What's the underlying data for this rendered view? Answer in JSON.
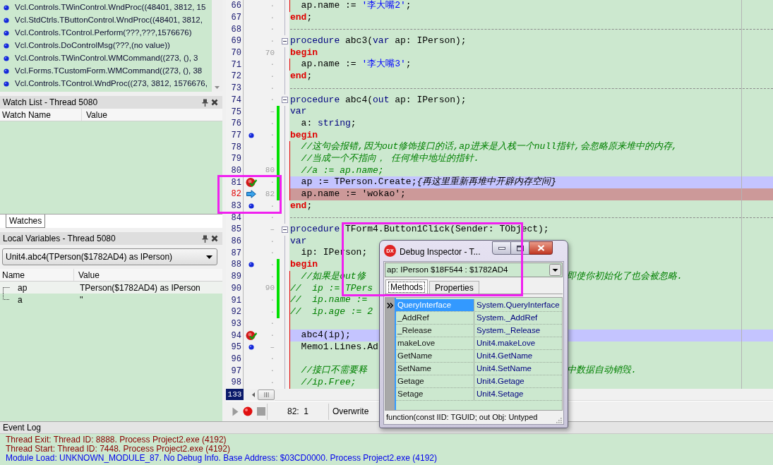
{
  "call_stack": {
    "frames": [
      "Vcl.Controls.TWinControl.WndProc((48401, 3812, 15",
      "Vcl.StdCtrls.TButtonControl.WndProc((48401, 3812,",
      "Vcl.Controls.TControl.Perform(???,???,1576676)",
      "Vcl.Controls.DoControlMsg(???,(no value))",
      "Vcl.Controls.TWinControl.WMCommand((273, (), 3",
      "Vcl.Forms.TCustomForm.WMCommand((273, (), 38",
      "Vcl.Controls.TControl.WndProc((273, 3812, 1576676,"
    ]
  },
  "watch_list": {
    "title": "Watch List - Thread 5080",
    "columns": [
      "Watch Name",
      "Value"
    ],
    "tabs": [
      {
        "label": "Watches",
        "selected": true
      }
    ]
  },
  "local_variables": {
    "title": "Local Variables - Thread 5080",
    "frame": "Unit4.abc4(TPerson($1782AD4) as IPerson)",
    "columns": [
      "Name",
      "Value"
    ],
    "rows": [
      {
        "name": "ap",
        "value": "TPerson($1782AD4) as IPerson",
        "selected": true
      },
      {
        "name": "a",
        "value": "''",
        "selected": false
      }
    ]
  },
  "editor": {
    "lines": [
      {
        "number": "66",
        "mark": "·",
        "kind": "code",
        "compiled": false,
        "modified": false,
        "fold": false,
        "block_guide": true,
        "tokens": [
          {
            "text": "  ap.name := ",
            "kind": "plain"
          },
          {
            "text": "'李大嘴2'",
            "kind": "string"
          },
          {
            "text": ";",
            "kind": "plain"
          }
        ]
      },
      {
        "number": "67",
        "mark": "·",
        "kind": "code",
        "compiled": false,
        "modified": false,
        "fold": false,
        "block_guide": false,
        "tokens": [
          {
            "text": "end",
            "kind": "reserved"
          },
          {
            "text": ";",
            "kind": "plain"
          }
        ]
      },
      {
        "number": "68",
        "mark": "·",
        "kind": "separator",
        "compiled": false,
        "modified": false,
        "fold": false,
        "block_guide": false
      },
      {
        "number": "69",
        "mark": "·",
        "kind": "code",
        "compiled": false,
        "modified": false,
        "fold": true,
        "block_guide": false,
        "tokens": [
          {
            "text": "procedure",
            "kind": "keyword"
          },
          {
            "text": " abc3(",
            "kind": "plain"
          },
          {
            "text": "var",
            "kind": "keyword"
          },
          {
            "text": " ap: IPerson);",
            "kind": "plain"
          }
        ]
      },
      {
        "number": "70",
        "mark": "70",
        "kind": "code",
        "compiled": false,
        "modified": false,
        "fold": false,
        "block_guide": false,
        "tokens": [
          {
            "text": "begin",
            "kind": "reserved"
          }
        ]
      },
      {
        "number": "71",
        "mark": "·",
        "kind": "code",
        "compiled": false,
        "modified": false,
        "fold": false,
        "block_guide": true,
        "tokens": [
          {
            "text": "  ap.name := ",
            "kind": "plain"
          },
          {
            "text": "'李大嘴3'",
            "kind": "string"
          },
          {
            "text": ";",
            "kind": "plain"
          }
        ]
      },
      {
        "number": "72",
        "mark": "·",
        "kind": "code",
        "compiled": false,
        "modified": false,
        "fold": false,
        "block_guide": false,
        "tokens": [
          {
            "text": "end",
            "kind": "reserved"
          },
          {
            "text": ";",
            "kind": "plain"
          }
        ]
      },
      {
        "number": "73",
        "mark": "·",
        "kind": "separator",
        "compiled": false,
        "modified": false,
        "fold": false,
        "block_guide": false
      },
      {
        "number": "74",
        "mark": "·",
        "kind": "code",
        "compiled": false,
        "modified": false,
        "fold": true,
        "block_guide": false,
        "tokens": [
          {
            "text": "procedure",
            "kind": "keyword"
          },
          {
            "text": " abc4(",
            "kind": "plain"
          },
          {
            "text": "out",
            "kind": "keyword"
          },
          {
            "text": " ap: IPerson);",
            "kind": "plain"
          }
        ]
      },
      {
        "number": "75",
        "mark": "–",
        "kind": "code",
        "compiled": false,
        "modified": true,
        "fold": false,
        "block_guide": false,
        "tokens": [
          {
            "text": "var",
            "kind": "keyword"
          }
        ]
      },
      {
        "number": "76",
        "mark": "·",
        "kind": "code",
        "compiled": false,
        "modified": true,
        "fold": false,
        "block_guide": false,
        "tokens": [
          {
            "text": "  a: ",
            "kind": "plain"
          },
          {
            "text": "string",
            "kind": "keyword"
          },
          {
            "text": ";",
            "kind": "plain"
          }
        ]
      },
      {
        "number": "77",
        "mark": "·",
        "kind": "code",
        "compiled": true,
        "modified": true,
        "fold": false,
        "block_guide": false,
        "tokens": [
          {
            "text": "begin",
            "kind": "reserved"
          }
        ]
      },
      {
        "number": "78",
        "mark": "·",
        "kind": "code",
        "compiled": false,
        "modified": true,
        "fold": false,
        "block_guide": true,
        "tokens": [
          {
            "text": "  //这句会报错,因为out修饰接口的话,ap进来是入栈一个null指针,会忽略原来堆中的内存,",
            "kind": "comment"
          }
        ]
      },
      {
        "number": "79",
        "mark": "·",
        "kind": "code",
        "compiled": false,
        "modified": true,
        "fold": false,
        "block_guide": true,
        "tokens": [
          {
            "text": "  //当成一个不指向， 任何堆中地址的指针.",
            "kind": "comment"
          }
        ]
      },
      {
        "number": "80",
        "mark": "80",
        "kind": "code",
        "compiled": false,
        "modified": true,
        "fold": false,
        "block_guide": true,
        "tokens": [
          {
            "text": "  //a := ap.name;",
            "kind": "comment"
          }
        ]
      },
      {
        "number": "81",
        "mark": "·",
        "kind": "breakpoint",
        "compiled": false,
        "modified": true,
        "fold": false,
        "block_guide": true,
        "tokens": [
          {
            "text": "  ap := TPerson.Create;",
            "kind": "plain"
          },
          {
            "text": "{再这里重新再堆中开辟内存空间}",
            "kind": "comment"
          }
        ]
      },
      {
        "number": "82",
        "mark": "82",
        "kind": "execution",
        "compiled": false,
        "modified": true,
        "fold": false,
        "block_guide": true,
        "tokens": [
          {
            "text": "  ap.name := ",
            "kind": "plain"
          },
          {
            "text": "'wokao'",
            "kind": "string"
          },
          {
            "text": ";",
            "kind": "plain"
          }
        ]
      },
      {
        "number": "83",
        "mark": "·",
        "kind": "code",
        "compiled": true,
        "modified": false,
        "fold": false,
        "block_guide": false,
        "tokens": [
          {
            "text": "end",
            "kind": "reserved"
          },
          {
            "text": ";",
            "kind": "plain"
          }
        ]
      },
      {
        "number": "84",
        "mark": "·",
        "kind": "separator",
        "compiled": false,
        "modified": false,
        "fold": false,
        "block_guide": false
      },
      {
        "number": "85",
        "mark": "–",
        "kind": "code",
        "compiled": false,
        "modified": false,
        "fold": true,
        "block_guide": false,
        "tokens": [
          {
            "text": "procedure",
            "kind": "keyword"
          },
          {
            "text": " TForm4.Button1Click(Sender: TObject);",
            "kind": "plain"
          }
        ]
      },
      {
        "number": "86",
        "mark": "·",
        "kind": "code",
        "compiled": false,
        "modified": false,
        "fold": false,
        "block_guide": false,
        "tokens": [
          {
            "text": "var",
            "kind": "keyword"
          }
        ]
      },
      {
        "number": "87",
        "mark": "·",
        "kind": "code",
        "compiled": false,
        "modified": false,
        "fold": false,
        "block_guide": false,
        "tokens": [
          {
            "text": "  ip: IPerson;",
            "kind": "plain"
          }
        ]
      },
      {
        "number": "88",
        "mark": "·",
        "kind": "code",
        "compiled": true,
        "modified": true,
        "fold": false,
        "block_guide": false,
        "tokens": [
          {
            "text": "begin",
            "kind": "reserved"
          }
        ]
      },
      {
        "number": "89",
        "mark": "·",
        "kind": "code",
        "compiled": false,
        "modified": true,
        "fold": false,
        "block_guide": true,
        "tokens": [
          {
            "text": "  //如果是out修",
            "kind": "comment"
          }
        ],
        "tokens_right": [
          {
            "text": "即使你初始化了也会被忽略.",
            "kind": "comment"
          }
        ]
      },
      {
        "number": "90",
        "mark": "90",
        "kind": "code",
        "compiled": false,
        "modified": true,
        "fold": false,
        "block_guide": true,
        "tokens": [
          {
            "text": "//  ip := TPers",
            "kind": "comment"
          }
        ]
      },
      {
        "number": "91",
        "mark": "·",
        "kind": "code",
        "compiled": false,
        "modified": true,
        "fold": false,
        "block_guide": true,
        "tokens": [
          {
            "text": "//  ip.name :=",
            "kind": "comment"
          }
        ]
      },
      {
        "number": "92",
        "mark": "·",
        "kind": "code",
        "compiled": false,
        "modified": true,
        "fold": false,
        "block_guide": true,
        "tokens": [
          {
            "text": "//  ip.age := 2",
            "kind": "comment"
          }
        ]
      },
      {
        "number": "93",
        "mark": "·",
        "kind": "code",
        "compiled": false,
        "modified": false,
        "fold": false,
        "block_guide": true
      },
      {
        "number": "94",
        "mark": "·",
        "kind": "breakpoint",
        "compiled": false,
        "modified": false,
        "fold": false,
        "block_guide": true,
        "tokens": [
          {
            "text": "  abc4(ip);",
            "kind": "plain"
          }
        ]
      },
      {
        "number": "95",
        "mark": "–",
        "kind": "code",
        "compiled": true,
        "modified": false,
        "fold": false,
        "block_guide": true,
        "tokens": [
          {
            "text": "  Memo1.Lines.Ad",
            "kind": "plain"
          }
        ]
      },
      {
        "number": "96",
        "mark": "·",
        "kind": "code",
        "compiled": false,
        "modified": false,
        "fold": false,
        "block_guide": true
      },
      {
        "number": "97",
        "mark": "·",
        "kind": "code",
        "compiled": false,
        "modified": false,
        "fold": false,
        "block_guide": true,
        "tokens": [
          {
            "text": "  //接口不需要释",
            "kind": "comment"
          }
        ],
        "tokens_right": [
          {
            "text": "中数据自动销毁.",
            "kind": "comment"
          }
        ]
      },
      {
        "number": "98",
        "mark": "·",
        "kind": "code",
        "compiled": false,
        "modified": false,
        "fold": false,
        "block_guide": true,
        "tokens": [
          {
            "text": "  //ip.Free;",
            "kind": "comment"
          }
        ]
      }
    ],
    "line_count": "133"
  },
  "status_bar": {
    "cursor": "82:  1",
    "mode": "Overwrite"
  },
  "debug_inspector": {
    "badge": "DX",
    "title": "Debug Inspector - T...",
    "expression": "ap: IPerson $18F544 : $1782AD4",
    "tabs": [
      {
        "label": "Methods",
        "selected": true
      },
      {
        "label": "Properties",
        "selected": false
      }
    ],
    "methods": [
      {
        "name": "QueryInterface",
        "value": "System.QueryInterface",
        "selected": true
      },
      {
        "name": "_AddRef",
        "value": "System._AddRef",
        "selected": false
      },
      {
        "name": "_Release",
        "value": "System._Release",
        "selected": false
      },
      {
        "name": "makeLove",
        "value": "Unit4.makeLove",
        "selected": false
      },
      {
        "name": "GetName",
        "value": "Unit4.GetName",
        "selected": false
      },
      {
        "name": "SetName",
        "value": "Unit4.SetName",
        "selected": false
      },
      {
        "name": "Getage",
        "value": "Unit4.Getage",
        "selected": false
      },
      {
        "name": "Setage",
        "value": "Unit4.Setage",
        "selected": false
      }
    ],
    "signature": "function(const IID: TGUID; out Obj: Untyped"
  },
  "event_log": {
    "title": "Event Log",
    "entries": [
      {
        "kind": "thread",
        "text": "Thread Exit: Thread ID: 8888. Process Project2.exe (4192)"
      },
      {
        "kind": "thread",
        "text": "Thread Start: Thread ID: 7448. Process Project2.exe (4192)"
      },
      {
        "kind": "module",
        "text": "Module Load: UNKNOWN_MODULE_87. No Debug Info. Base Address: $03CD0000. Process Project2.exe (4192)"
      }
    ]
  },
  "annotations": [
    {
      "kind": "rectangle"
    },
    {
      "kind": "rectangle"
    }
  ]
}
